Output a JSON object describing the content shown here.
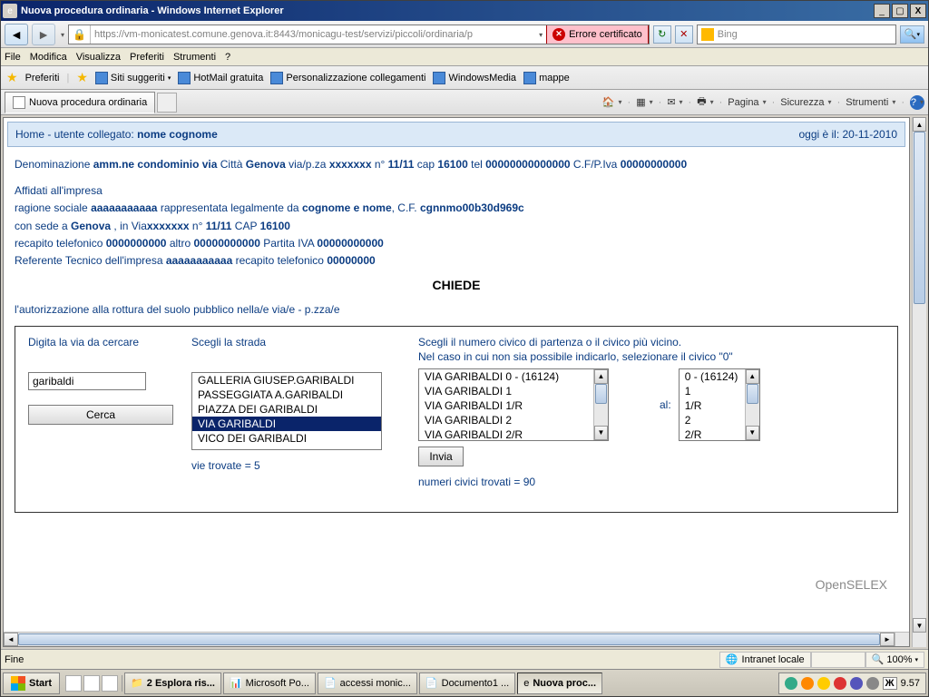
{
  "window": {
    "title": "Nuova procedura ordinaria - Windows Internet Explorer"
  },
  "titlebar_buttons": {
    "min": "_",
    "max": "▢",
    "close": "X"
  },
  "nav": {
    "url": "https://vm-monicatest.comune.genova.it:8443/monicagu-test/servizi/piccoli/ordinaria/p",
    "cert_error": "Errore certificato",
    "refresh": "↻",
    "stop": "✕",
    "search_engine": "Bing",
    "search_icon": "🔍"
  },
  "menu": [
    "File",
    "Modifica",
    "Visualizza",
    "Preferiti",
    "Strumenti",
    "?"
  ],
  "favbar": {
    "label": "Preferiti",
    "items": [
      "Siti suggeriti",
      "HotMail gratuita",
      "Personalizzazione collegamenti",
      "WindowsMedia",
      "mappe"
    ]
  },
  "tab": {
    "title": "Nuova procedura ordinaria"
  },
  "cmdbar": [
    "Pagina",
    "Sicurezza",
    "Strumenti"
  ],
  "page": {
    "home_label": "Home - utente collegato:",
    "user": "nome cognome",
    "date_label": "oggi è il: 20-11-2010",
    "line1a": "Denominazione ",
    "line1b": "amm.ne condominio via",
    "line1c": " Città ",
    "line1d": "Genova",
    "line1e": " via/p.za ",
    "line1f": "xxxxxxx",
    "line1g": " n° ",
    "line1h": "11/11",
    "line1i": " cap ",
    "line1j": "16100",
    "line1k": " tel ",
    "line1l": "00000000000000",
    "line1m": " C.F/P.Iva ",
    "line1n": "00000000000",
    "affidati": "Affidati all'impresa",
    "line2a": "ragione sociale ",
    "line2b": "aaaaaaaaaaa",
    "line2c": " rappresentata legalmente da ",
    "line2d": "cognome e nome",
    "line2e": ", C.F. ",
    "line2f": "cgnnmo00b30d969c",
    "line3a": "con sede a ",
    "line3b": "Genova",
    "line3c": " , in Via",
    "line3d": "xxxxxxx",
    "line3e": " n° ",
    "line3f": "11/11",
    "line3g": " CAP ",
    "line3h": "16100",
    "line4a": "recapito telefonico ",
    "line4b": "0000000000",
    "line4c": " altro ",
    "line4d": "00000000000",
    "line4e": " Partita IVA ",
    "line4f": "00000000000",
    "line5a": "Referente Tecnico dell'impresa ",
    "line5b": "aaaaaaaaaaa",
    "line5c": " recapito telefonico ",
    "line5d": "00000000",
    "chiede": "CHIEDE",
    "auth_text": "l'autorizzazione alla rottura del suolo pubblico nella/e via/e - p.zza/e",
    "col1_label": "Digita la via da cercare",
    "search_value": "garibaldi",
    "cerca": "Cerca",
    "col2_label": "Scegli la strada",
    "streets": [
      "GALLERIA GIUSEP.GARIBALDI",
      "PASSEGGIATA A.GARIBALDI",
      "PIAZZA DEI GARIBALDI",
      "VIA GARIBALDI",
      "VICO DEI GARIBALDI"
    ],
    "vie_trovate": "vie trovate = 5",
    "col3_line1": "Scegli il numero civico di partenza o il civico più vicino.",
    "col3_line2": "Nel caso in cui non sia possibile indicarlo, selezionare il civico \"0\"",
    "civics_a": [
      "VIA GARIBALDI 0 - (16124)",
      "VIA GARIBALDI 1",
      "VIA GARIBALDI 1/R",
      "VIA GARIBALDI 2",
      "VIA GARIBALDI 2/R"
    ],
    "al": "al:",
    "civics_b": [
      "0 - (16124)",
      "1",
      "1/R",
      "2",
      "2/R"
    ],
    "invia": "Invia",
    "numeri_trovati": "numeri civici trovati = 90",
    "brand": "OpenSELEX"
  },
  "status": {
    "left": "Fine",
    "zone": "Intranet locale",
    "zoom": "100%"
  },
  "taskbar": {
    "start": "Start",
    "tasks": [
      "2 Esplora ris...",
      "Microsoft Po...",
      "accessi monic...",
      "Documento1 ...",
      "Nuova proc..."
    ],
    "time": "9.57"
  }
}
